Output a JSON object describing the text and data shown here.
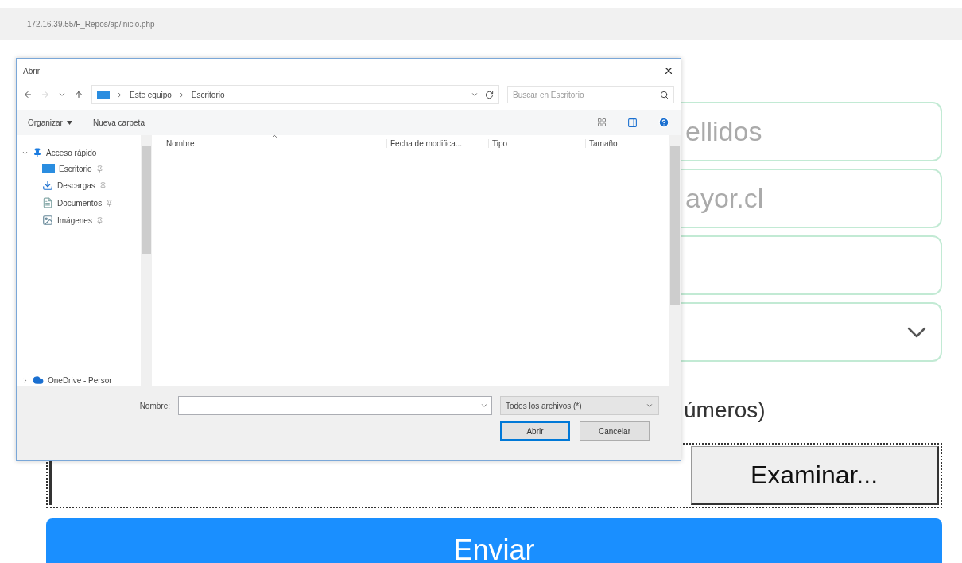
{
  "address_bar": {
    "url": "172.16.39.55/F_Repos/ap/inicio.php"
  },
  "form": {
    "fields": [
      {
        "kind": "text",
        "placeholder": "ellidos"
      },
      {
        "kind": "text",
        "placeholder": "ayor.cl"
      },
      {
        "kind": "text"
      },
      {
        "kind": "select"
      }
    ],
    "file_label": "úmeros)",
    "browse_button": "Examinar...",
    "submit_button": "Enviar"
  },
  "dialog": {
    "title": "Abrir",
    "breadcrumb": [
      "Este equipo",
      "Escritorio"
    ],
    "search": {
      "placeholder": "Buscar en Escritorio"
    },
    "toolbar": {
      "organize": "Organizar",
      "new_folder": "Nueva carpeta"
    },
    "nav": [
      {
        "label": "Acceso rápido",
        "kind": "quick",
        "expanded": true,
        "children": [
          {
            "label": "Escritorio",
            "kind": "desktop"
          },
          {
            "label": "Descargas",
            "kind": "downloads"
          },
          {
            "label": "Documentos",
            "kind": "documents"
          },
          {
            "label": "Imágenes",
            "kind": "images"
          }
        ]
      },
      {
        "label": "OneDrive - Persor",
        "kind": "cloud",
        "expanded": false
      }
    ],
    "columns": [
      "Nombre",
      "Fecha de modifica...",
      "Tipo",
      "Tamaño"
    ],
    "filename_label": "Nombre:",
    "file_type": "Todos los archivos (*)",
    "buttons": {
      "open": "Abrir",
      "cancel": "Cancelar"
    }
  }
}
